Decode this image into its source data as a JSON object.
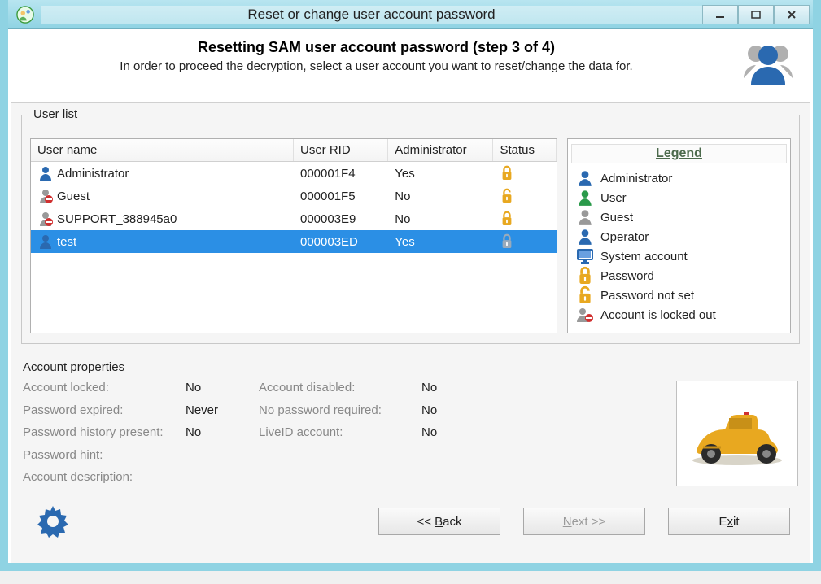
{
  "window": {
    "title": "Reset or change user account password"
  },
  "header": {
    "title": "Resetting SAM user account password (step 3 of 4)",
    "subtitle": "In order to proceed the decryption, select a user account you want to reset/change the data for."
  },
  "userlist": {
    "label": "User list",
    "columns": {
      "name": "User name",
      "rid": "User RID",
      "admin": "Administrator",
      "status": "Status"
    },
    "rows": [
      {
        "icon": "admin",
        "badge": "",
        "name": "Administrator",
        "rid": "000001F4",
        "admin": "Yes",
        "status": "lock-closed",
        "selected": false
      },
      {
        "icon": "guest",
        "badge": "blocked",
        "name": "Guest",
        "rid": "000001F5",
        "admin": "No",
        "status": "lock-open",
        "selected": false
      },
      {
        "icon": "guest",
        "badge": "blocked",
        "name": "SUPPORT_388945a0",
        "rid": "000003E9",
        "admin": "No",
        "status": "lock-closed",
        "selected": false
      },
      {
        "icon": "admin",
        "badge": "",
        "name": "test",
        "rid": "000003ED",
        "admin": "Yes",
        "status": "lock-closed",
        "selected": true
      }
    ]
  },
  "legend": {
    "title": "Legend",
    "items": [
      {
        "icon": "admin",
        "label": "Administrator"
      },
      {
        "icon": "user",
        "label": "User"
      },
      {
        "icon": "guest",
        "label": "Guest"
      },
      {
        "icon": "operator",
        "label": "Operator"
      },
      {
        "icon": "system",
        "label": "System account"
      },
      {
        "icon": "lock-closed",
        "label": "Password"
      },
      {
        "icon": "lock-open",
        "label": "Password not set"
      },
      {
        "icon": "locked-out",
        "label": "Account is locked out"
      }
    ]
  },
  "properties": {
    "title": "Account properties",
    "account_locked_label": "Account locked:",
    "account_locked_value": "No",
    "password_expired_label": "Password expired:",
    "password_expired_value": "Never",
    "history_label": "Password history present:",
    "history_value": "No",
    "hint_label": "Password hint:",
    "hint_value": "",
    "description_label": "Account description:",
    "description_value": "",
    "disabled_label": "Account disabled:",
    "disabled_value": "No",
    "nopass_label": "No password required:",
    "nopass_value": "No",
    "liveid_label": "LiveID account:",
    "liveid_value": "No"
  },
  "footer": {
    "back": "<< Back",
    "next": "Next >>",
    "exit": "Exit"
  }
}
